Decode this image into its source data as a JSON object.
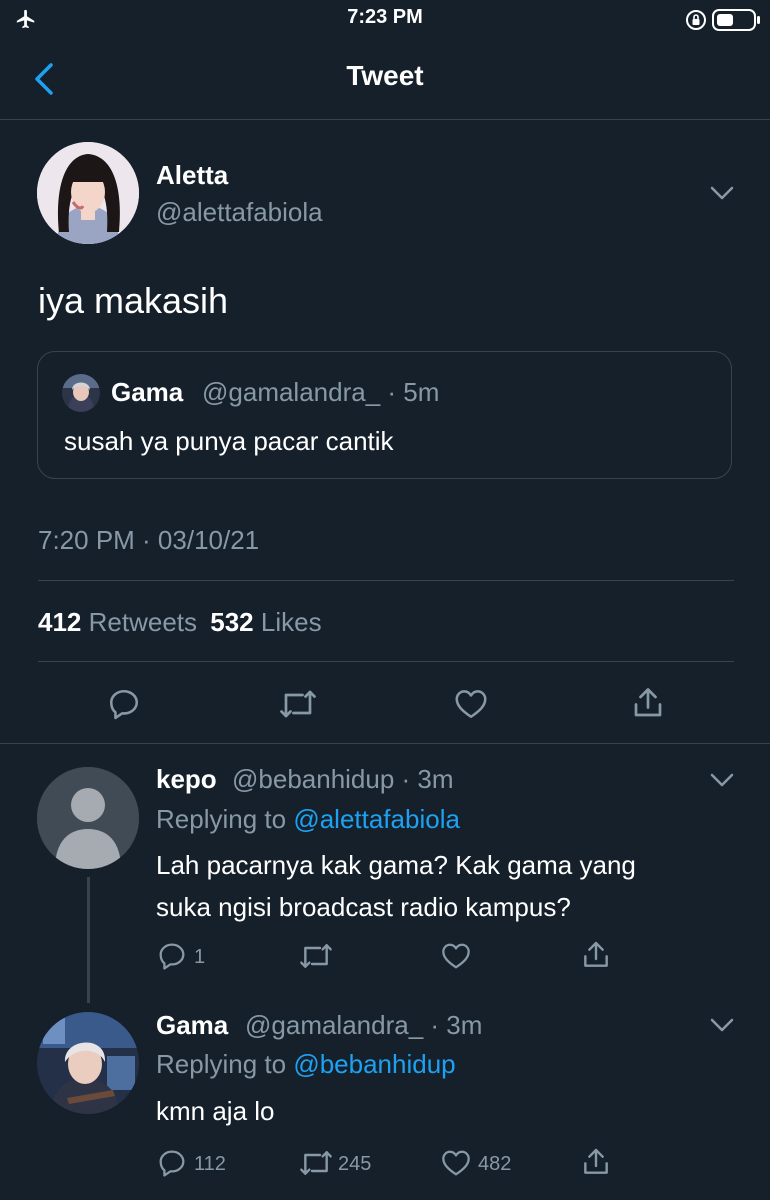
{
  "status_bar": {
    "time": "7:23 PM"
  },
  "header": {
    "title": "Tweet"
  },
  "main_tweet": {
    "name": "Aletta",
    "handle": "@alettafabiola",
    "text": "iya makasih",
    "quote": {
      "name": "Gama",
      "handle_time": "@gamalandra_ · 5m",
      "text": "susah ya punya pacar cantik"
    },
    "timestamp": "7:20 PM · 03/10/21",
    "retweets_count": "412",
    "retweets_label": "Retweets",
    "likes_count": "532",
    "likes_label": "Likes"
  },
  "replies": [
    {
      "name": "kepo",
      "handle_time": "@bebanhidup · 3m",
      "replying_prefix": "Replying to",
      "replying_to": "@alettafabiola",
      "text_line1": "Lah pacarnya kak gama? Kak gama yang",
      "text_line2": "suka ngisi broadcast radio kampus?",
      "reply_count": "1",
      "retweet_count": "",
      "like_count": ""
    },
    {
      "name": "Gama",
      "handle_time": "@gamalandra_ · 3m",
      "replying_prefix": "Replying to",
      "replying_to": "@bebanhidup",
      "text_line1": "kmn aja lo",
      "reply_count": "112",
      "retweet_count": "245",
      "like_count": "482"
    }
  ],
  "colors": {
    "background": "#15202b",
    "secondary_text": "#8899a6",
    "accent": "#1da1f2",
    "divider": "#38444d"
  }
}
